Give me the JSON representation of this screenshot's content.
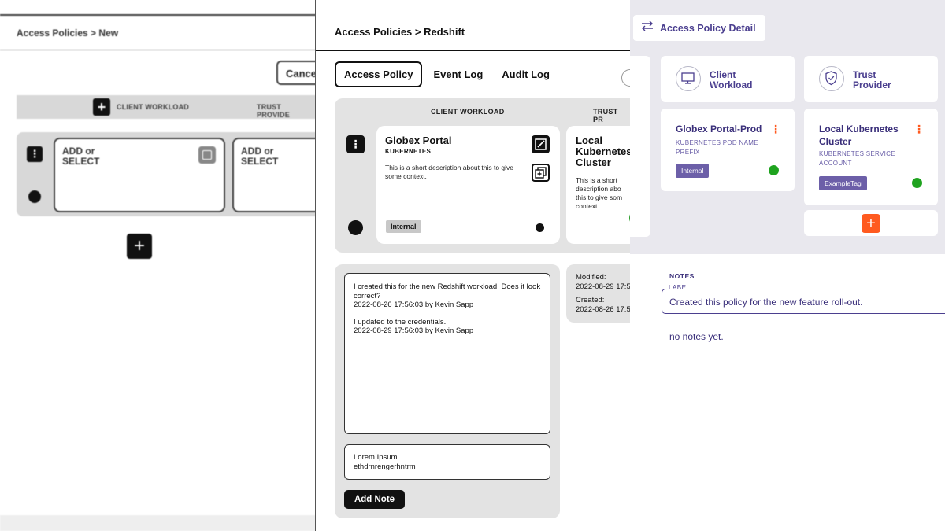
{
  "panel1": {
    "breadcrumb": "Access Policies > New",
    "cancel_label": "Cance",
    "columns": [
      "CLIENT WORKLOAD",
      "TRUST PROVIDE"
    ],
    "card1_title": "ADD or\nSELECT",
    "card2_title": "ADD or\nSELECT"
  },
  "panel2": {
    "breadcrumb": "Access Policies > Redshift",
    "tabs": [
      {
        "label": "Access Policy"
      },
      {
        "label": "Event Log"
      },
      {
        "label": "Audit Log"
      }
    ],
    "columns": [
      "CLIENT WORKLOAD",
      "TRUST PR"
    ],
    "workload_card": {
      "title": "Globex Portal",
      "subtitle": "KUBERNETES",
      "description": "This is a short description about this to give some context.",
      "tag": "Internal"
    },
    "provider_card": {
      "title": "Local\nKubernetes\nCluster",
      "description": "This is a short\ndescription abo\nthis to give som\ncontext."
    },
    "notes": [
      {
        "text": "I created this for the new Redshift workload. Does it look correct?",
        "meta": "2022-08-26  17:56:03 by Kevin Sapp"
      },
      {
        "text": "I updated to the credentials.",
        "meta": "2022-08-29  17:56:03 by Kevin Sapp"
      }
    ],
    "note_input_value": "Lorem Ipsum\nethdrnrengerhntrm",
    "add_note_label": "Add Note",
    "meta": {
      "modified_label": "Modified:",
      "modified_value": "2022-08-29  17:5",
      "created_label": "Created:",
      "created_value": "2022-08-26  17:5"
    }
  },
  "panel3": {
    "title": "Access Policy Detail",
    "header_cards": [
      {
        "label": "Client\nWorkload",
        "icon": "monitor-icon"
      },
      {
        "label": "Trust\nProvider",
        "icon": "shield-check-icon"
      }
    ],
    "workload_card": {
      "title": "Globex Portal-Prod",
      "subtitle": "KUBERNETES POD NAME\nPREFIX",
      "tag": "Internal"
    },
    "provider_card": {
      "title": "Local Kubernetes\nCluster",
      "subtitle": "KUBERNETES SERVICE\nACCOUNT",
      "tag": "ExampleTag"
    },
    "notes_heading": "NOTES",
    "field_label": "LABEL",
    "field_value": "Created this policy for the new feature roll-out.",
    "empty_notes": "no notes yet."
  },
  "colors": {
    "accent_orange": "#ff5a1f",
    "purple": "#4b3f8f",
    "status_green": "#1fa31f"
  }
}
